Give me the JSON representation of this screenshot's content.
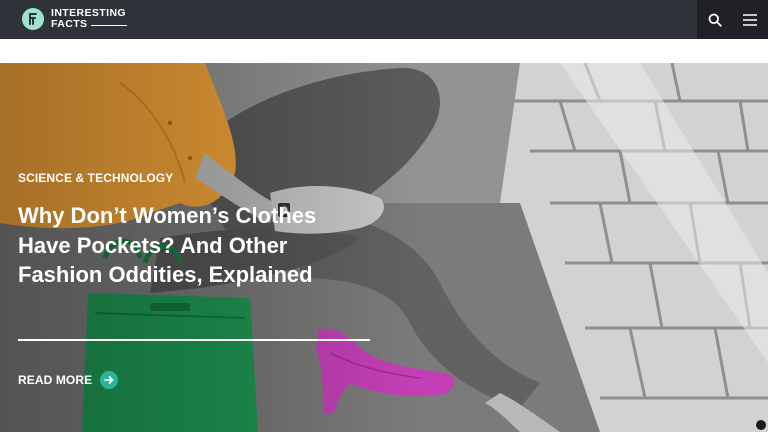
{
  "brand": {
    "line1": "INTERESTING",
    "line2": "FACTS"
  },
  "header": {
    "icons": [
      "search-icon",
      "menu-icon"
    ],
    "background": "#30323a",
    "nav_background": "#1f2126"
  },
  "hero": {
    "category": "SCIENCE & TECHNOLOGY",
    "headline": "Why Don’t Women’s Clothes Have Pockets? And Other Fashion Oddities, Explained",
    "cta_label": "READ MORE",
    "cta_icon": "arrow-right-icon",
    "accent_color": "#2bb597",
    "image_colors": {
      "shirt": "#f5a53a",
      "bag": "#1f9a55",
      "shoes": "#c43fb7"
    }
  }
}
